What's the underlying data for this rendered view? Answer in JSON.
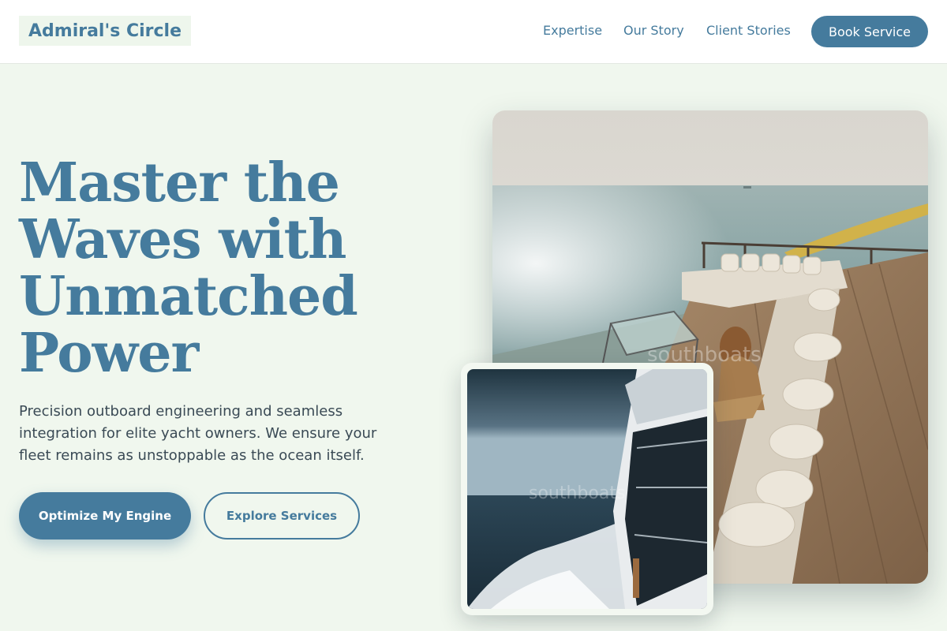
{
  "header": {
    "logo": "Admiral's Circle",
    "nav": {
      "expertise": "Expertise",
      "story": "Our Story",
      "clients": "Client Stories"
    },
    "cta": "Book Service"
  },
  "hero": {
    "title_lines": [
      "Master the",
      "Waves with",
      "Unmatched",
      "Power"
    ],
    "description": "Precision outboard engineering and seamless integration for elite yacht owners. We ensure your fleet remains as unstoppable as the ocean itself.",
    "primary_button": "Optimize My Engine",
    "secondary_button": "Explore Services"
  },
  "images": {
    "main": {
      "alt": "Woman relaxing on a yacht deck with sofas and cushions overlooking the sea",
      "watermark": "southboats"
    },
    "secondary": {
      "alt": "Side of a white yacht speeding through the ocean leaving white wake",
      "watermark": "southboats"
    }
  },
  "colors": {
    "brand": "#457b9d",
    "background": "#f0f7ee",
    "text_dark": "#3a4a55"
  }
}
